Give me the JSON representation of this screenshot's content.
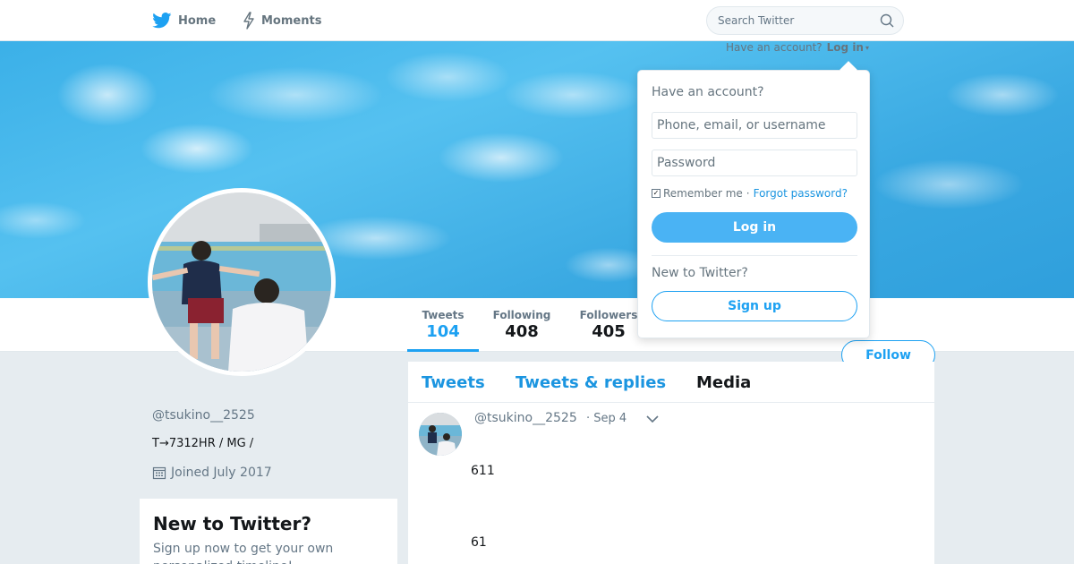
{
  "nav": {
    "home_label": "Home",
    "moments_label": "Moments",
    "search_placeholder": "Search Twitter",
    "home_icon": "twitter-bird-icon",
    "moments_icon": "lightning-icon",
    "search_icon": "search-icon"
  },
  "header_login": {
    "prompt": "Have an account?",
    "link": "Log in",
    "caret": "▾"
  },
  "login_dropdown": {
    "title": "Have an account?",
    "username_placeholder": "Phone, email, or username",
    "password_placeholder": "Password",
    "remember_label": "Remember me",
    "separator": "·",
    "forgot_label": "Forgot password?",
    "login_button": "Log in",
    "new_label": "New to Twitter?",
    "signup_button": "Sign up",
    "remember_checked": true
  },
  "profile": {
    "handle": "@tsukino__2525",
    "bio": "T→7312HR / MG /",
    "joined": "Joined July 2017",
    "follow_button": "Follow"
  },
  "stats": {
    "tweets_label": "Tweets",
    "tweets_value": "104",
    "following_label": "Following",
    "following_value": "408",
    "followers_label": "Followers",
    "followers_value": "405"
  },
  "signup_card": {
    "title": "New to Twitter?",
    "text": "Sign up now to get your own personalized timeline!"
  },
  "timeline": {
    "tabs": [
      {
        "label": "Tweets"
      },
      {
        "label": "Tweets & replies"
      },
      {
        "label": "Media"
      }
    ],
    "tweet": {
      "handle": "@tsukino__2525",
      "date": "· Sep 4",
      "line1": "611",
      "line2": "61"
    }
  },
  "colors": {
    "accent": "#1da1f2",
    "link": "#1b95e0",
    "login_button": "#4ab3f4",
    "background": "#e6ecf0"
  }
}
